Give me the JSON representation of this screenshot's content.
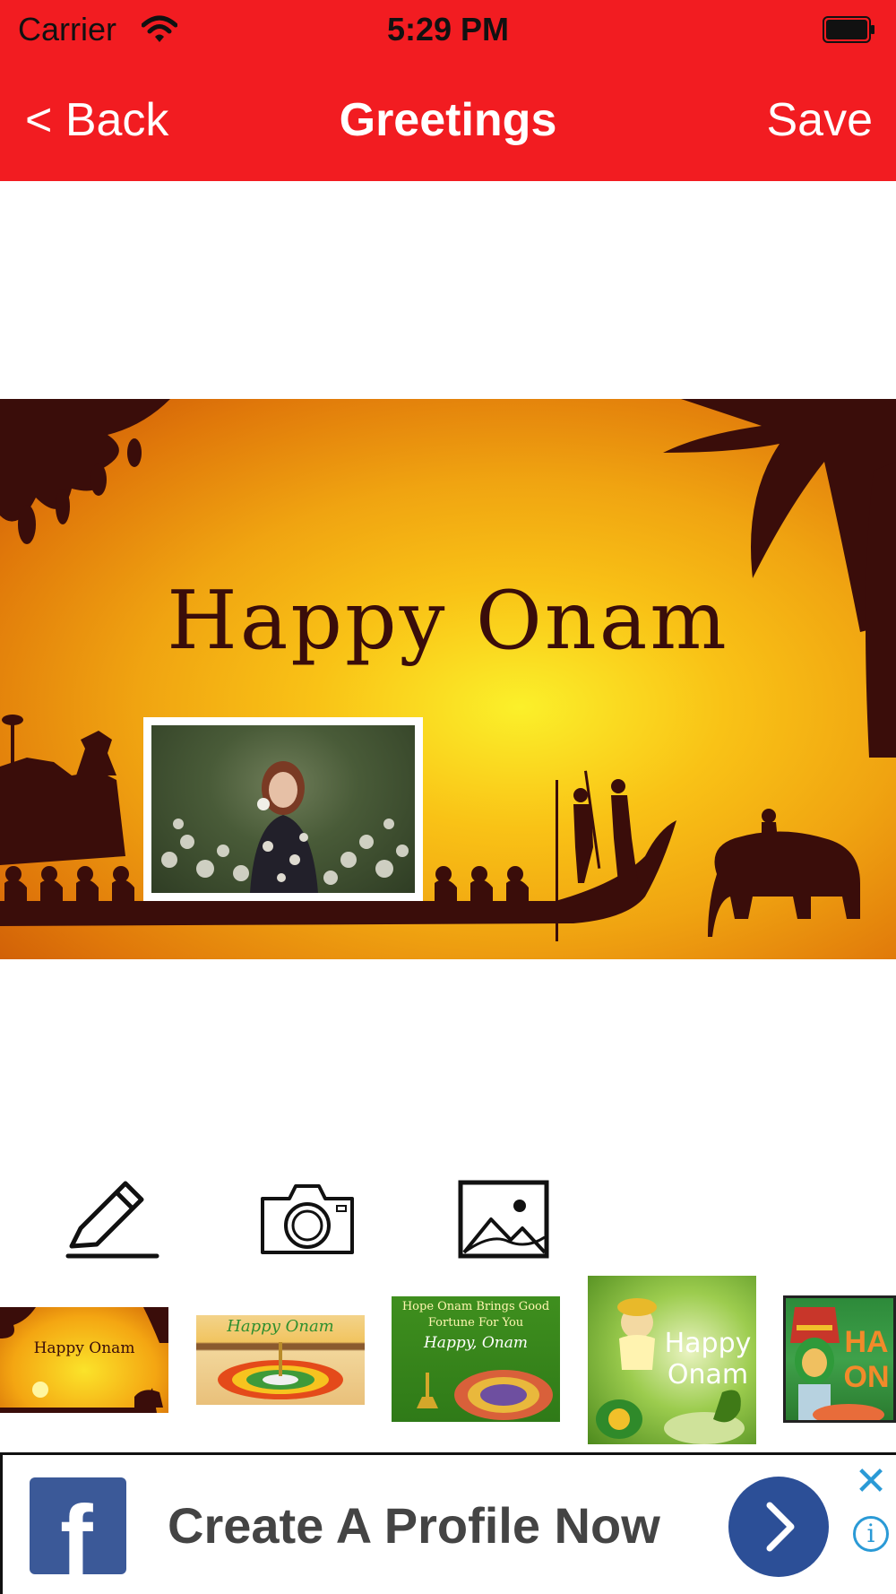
{
  "status_bar": {
    "carrier": "Carrier",
    "time": "5:29 PM"
  },
  "nav": {
    "back_label": "< Back",
    "title": "Greetings",
    "save_label": "Save"
  },
  "card": {
    "title": "Happy Onam"
  },
  "tools": [
    {
      "name": "edit-text-icon"
    },
    {
      "name": "camera-icon"
    },
    {
      "name": "gallery-icon"
    }
  ],
  "thumbnails": [
    {
      "label": "Happy Onam"
    },
    {
      "label": "Happy Onam"
    },
    {
      "label_line1": "Hope Onam Brings Good",
      "label_line2": "Fortune For You",
      "label_line3": "Happy, Onam"
    },
    {
      "label": "Happy Onam"
    },
    {
      "label": "HA ON"
    }
  ],
  "ad": {
    "brand_letter": "f",
    "text": "Create A Profile Now",
    "close_symbol": "✕",
    "info_symbol": "i"
  },
  "colors": {
    "nav_background": "#f21c21",
    "facebook_blue": "#3b5998"
  }
}
